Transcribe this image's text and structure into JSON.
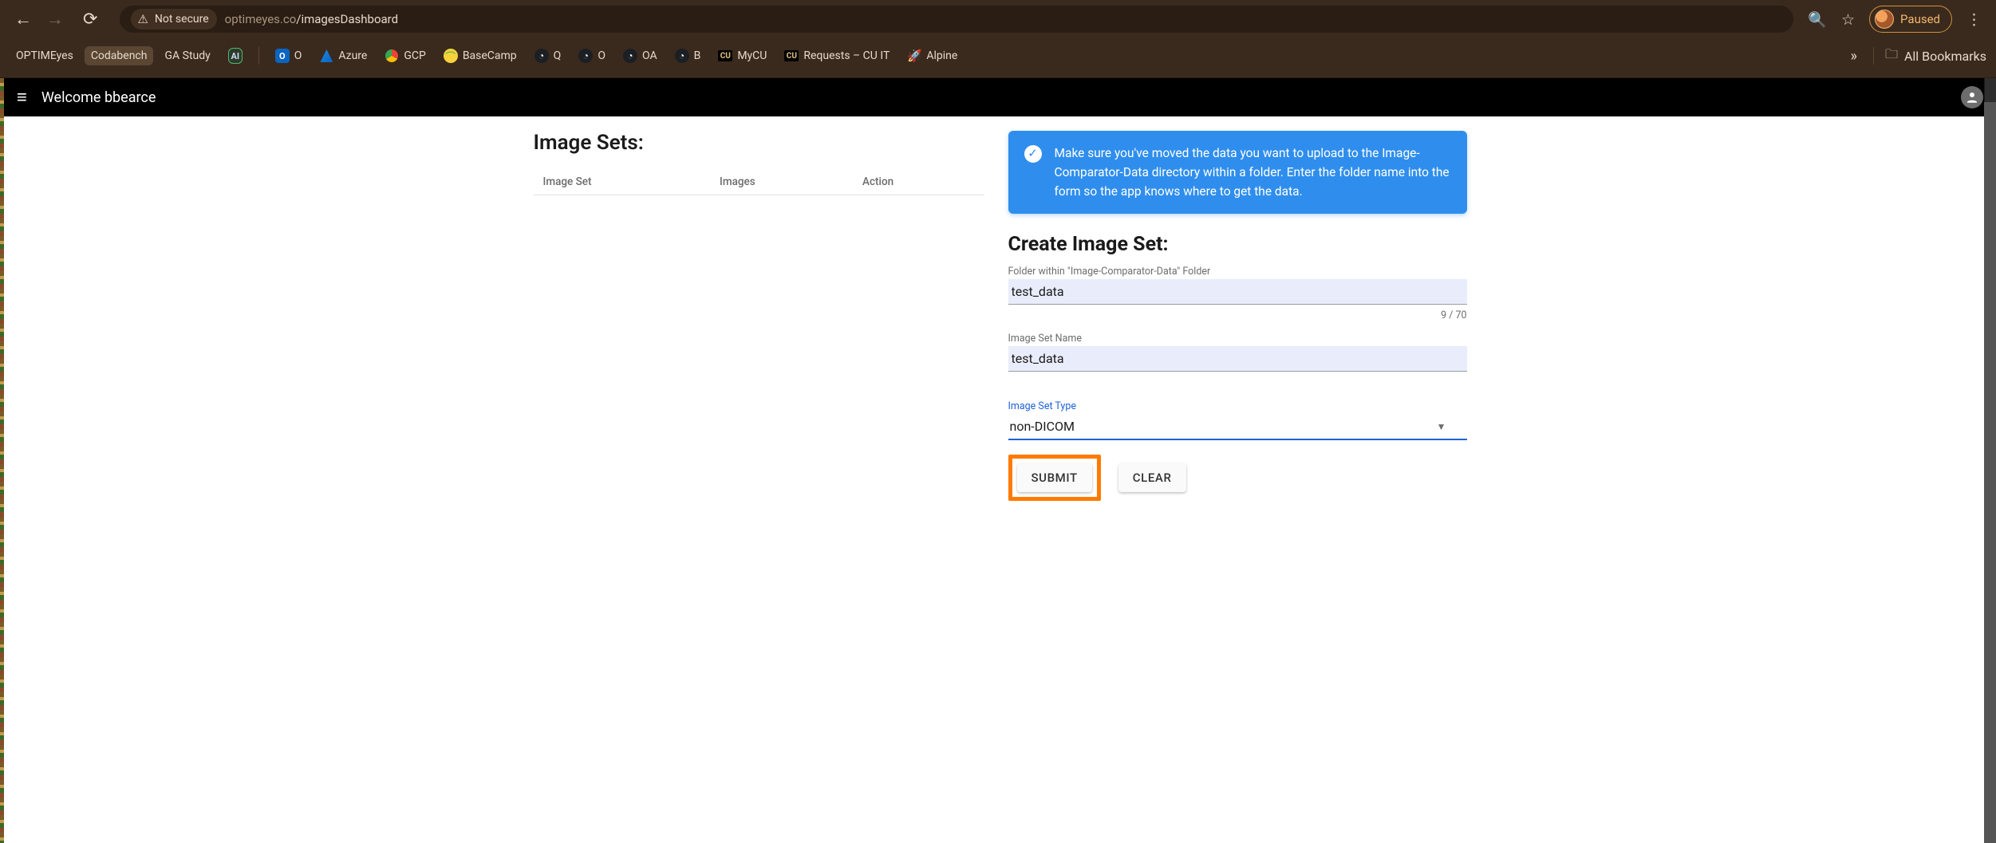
{
  "browser": {
    "security_label": "Not secure",
    "url_host": "optimeyes.co",
    "url_path": "/imagesDashboard",
    "paused_label": "Paused",
    "all_bookmarks_label": "All Bookmarks"
  },
  "bookmarks": [
    {
      "label": "OPTIMEyes",
      "fav": "none",
      "hilite": false
    },
    {
      "label": "Codabench",
      "fav": "none",
      "hilite": true
    },
    {
      "label": "GA Study",
      "fav": "none",
      "hilite": false
    },
    {
      "label": "AI",
      "fav": "ai",
      "hilite": false
    },
    {
      "label": "O",
      "fav": "outlook",
      "hilite": false
    },
    {
      "label": "Azure",
      "fav": "azure",
      "hilite": false
    },
    {
      "label": "GCP",
      "fav": "gcp",
      "hilite": false
    },
    {
      "label": "BaseCamp",
      "fav": "basecamp",
      "hilite": false
    },
    {
      "label": "Q",
      "fav": "gh",
      "hilite": false
    },
    {
      "label": "O",
      "fav": "gh",
      "hilite": false
    },
    {
      "label": "OA",
      "fav": "gh",
      "hilite": false
    },
    {
      "label": "B",
      "fav": "gh",
      "hilite": false
    },
    {
      "label": "MyCU",
      "fav": "mycu",
      "hilite": false
    },
    {
      "label": "Requests – CU IT",
      "fav": "mycu",
      "hilite": false
    },
    {
      "label": "Alpine",
      "fav": "alpine",
      "hilite": false
    }
  ],
  "app": {
    "welcome": "Welcome bbearce"
  },
  "left": {
    "heading": "Image Sets:",
    "columns": [
      "Image Set",
      "Images",
      "Action"
    ]
  },
  "banner": {
    "text": "Make sure you've moved the data you want to upload to the Image-Comparator-Data directory within a folder. Enter the folder name into the form so the app knows where to get the data."
  },
  "form": {
    "heading": "Create Image Set:",
    "folder_label": "Folder within \"Image-Comparator-Data\" Folder",
    "folder_value": "test_data",
    "folder_counter": "9 / 70",
    "name_label": "Image Set Name",
    "name_value": "test_data",
    "type_label": "Image Set Type",
    "type_value": "non-DICOM",
    "submit": "SUBMIT",
    "clear": "CLEAR"
  }
}
